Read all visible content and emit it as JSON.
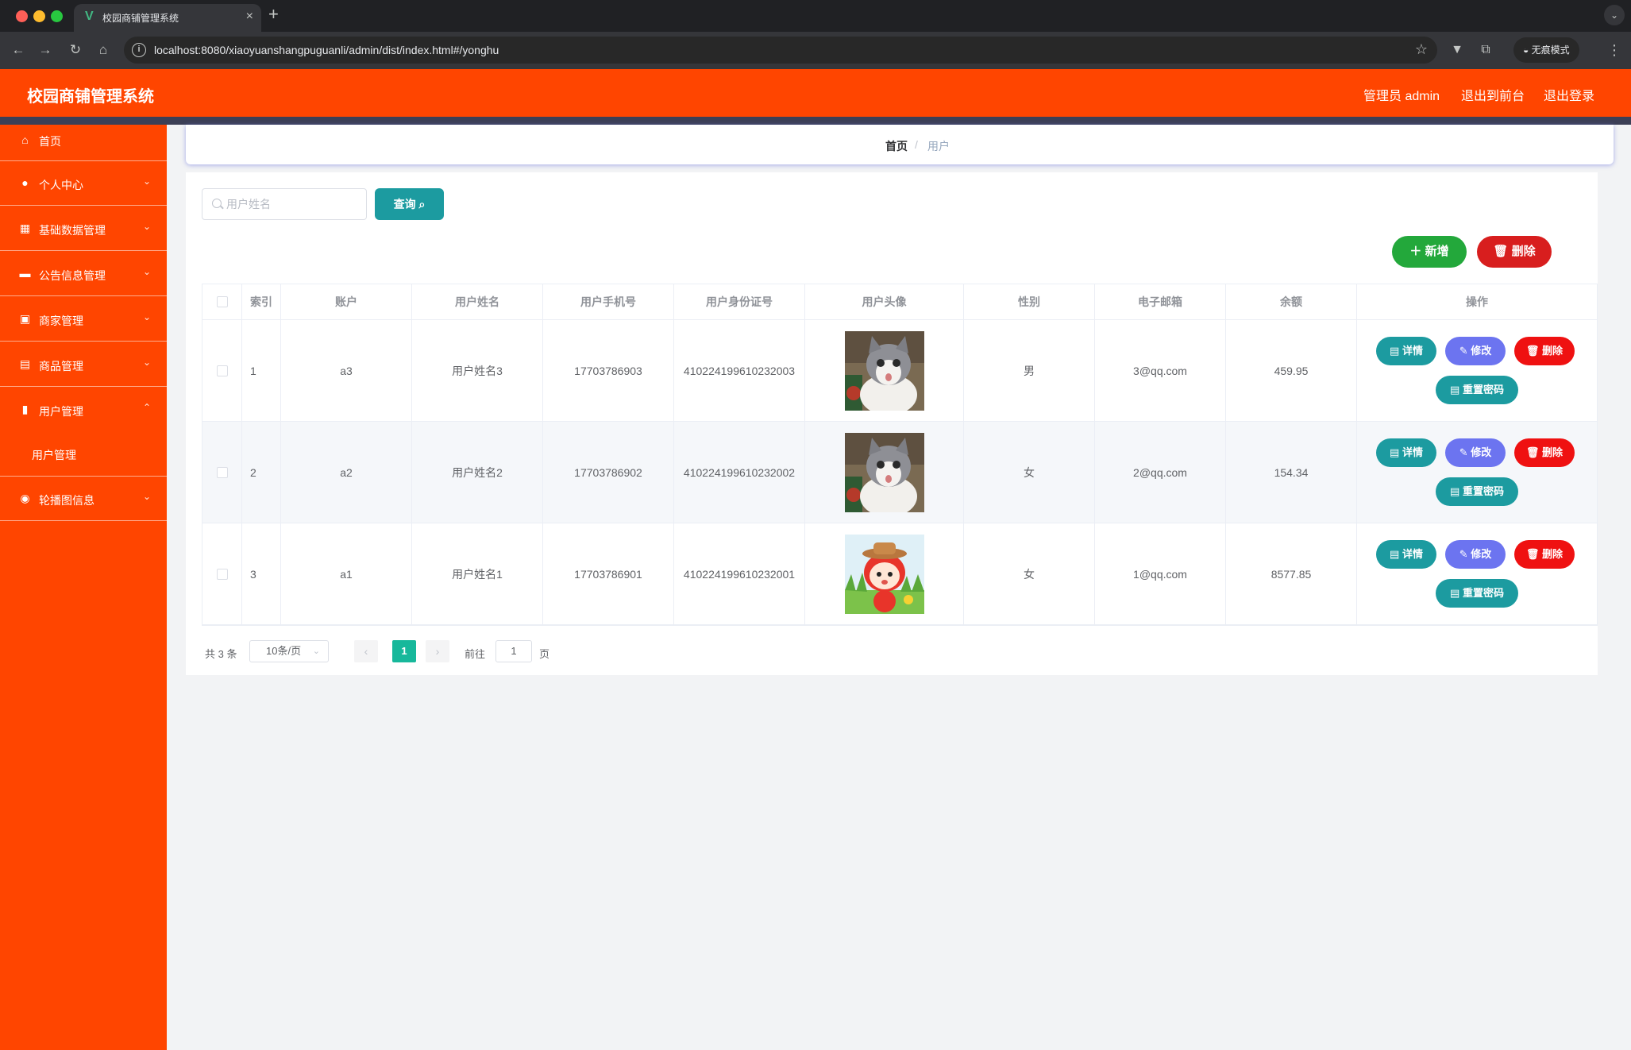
{
  "browser": {
    "tab_title": "校园商铺管理系统",
    "url": "localhost:8080/xiaoyuanshangpuguanli/admin/dist/index.html#/yonghu",
    "incognito_label": "无痕模式"
  },
  "header": {
    "title": "校园商铺管理系统",
    "admin_label": "管理员 admin",
    "front_label": "退出到前台",
    "logout_label": "退出登录"
  },
  "sidebar": {
    "items": [
      {
        "label": "首页",
        "icon": "home-icon"
      },
      {
        "label": "个人中心",
        "icon": "user-icon"
      },
      {
        "label": "基础数据管理",
        "icon": "grid-icon"
      },
      {
        "label": "公告信息管理",
        "icon": "ticket-icon"
      },
      {
        "label": "商家管理",
        "icon": "shop-icon"
      },
      {
        "label": "商品管理",
        "icon": "briefcase-icon"
      },
      {
        "label": "用户管理",
        "icon": "chart-icon"
      },
      {
        "label": "轮播图信息",
        "icon": "location-icon"
      }
    ],
    "submenu": {
      "label": "用户管理"
    }
  },
  "breadcrumb": {
    "home": "首页",
    "separator": "/",
    "current": "用户"
  },
  "search": {
    "placeholder": "用户姓名",
    "query_label": "查询"
  },
  "actions": {
    "add_label": "新增",
    "delete_label": "删除"
  },
  "table": {
    "columns": [
      "索引",
      "账户",
      "用户姓名",
      "用户手机号",
      "用户身份证号",
      "用户头像",
      "性别",
      "电子邮箱",
      "余额",
      "操作"
    ],
    "rows": [
      {
        "index": "1",
        "account": "a3",
        "name": "用户姓名3",
        "phone": "17703786903",
        "id_card": "410224199610232003",
        "avatar": "cat",
        "gender": "男",
        "email": "3@qq.com",
        "balance": "459.95"
      },
      {
        "index": "2",
        "account": "a2",
        "name": "用户姓名2",
        "phone": "17703786902",
        "id_card": "410224199610232002",
        "avatar": "cat",
        "gender": "女",
        "email": "2@qq.com",
        "balance": "154.34"
      },
      {
        "index": "3",
        "account": "a1",
        "name": "用户姓名1",
        "phone": "17703786901",
        "id_card": "410224199610232001",
        "avatar": "cartoon-girl",
        "gender": "女",
        "email": "1@qq.com",
        "balance": "8577.85"
      }
    ],
    "op_labels": {
      "detail": "详情",
      "edit": "修改",
      "delete": "删除",
      "reset": "重置密码"
    }
  },
  "pagination": {
    "total_text": "共 3 条",
    "page_size": "10条/页",
    "current_page": "1",
    "goto_label": "前往",
    "goto_value": "1",
    "page_suffix": "页"
  },
  "colors": {
    "brand": "#ff4500",
    "teal": "#1c9ba0",
    "purple": "#6c74f0",
    "danger": "#ef1111",
    "success": "#23a83b",
    "pager_active": "#17b89b"
  }
}
